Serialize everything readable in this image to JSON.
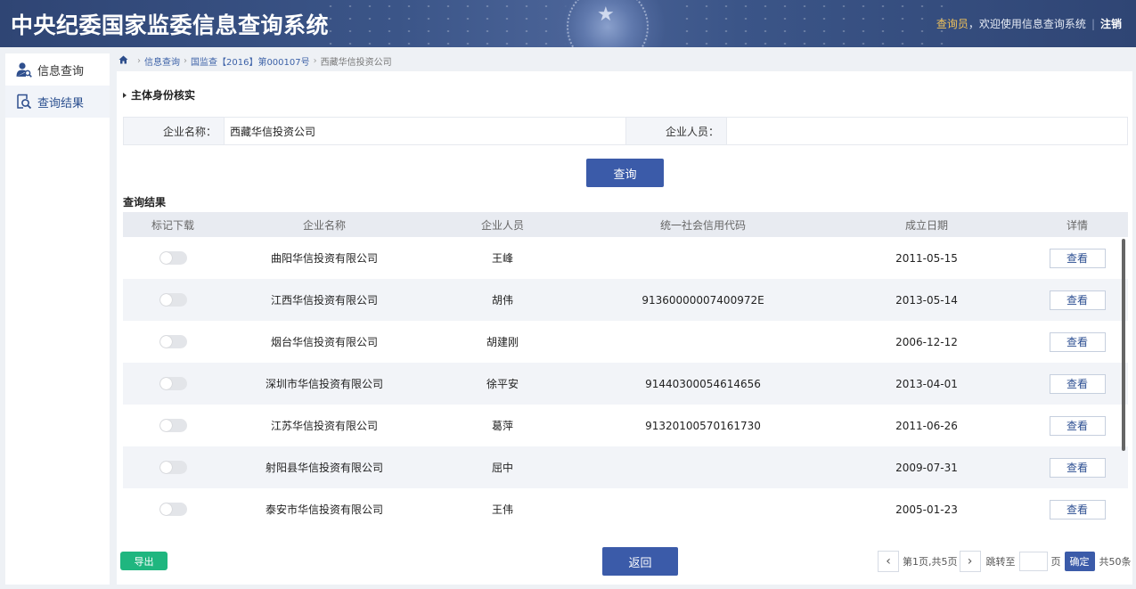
{
  "header": {
    "title": "中央纪委国家监委信息查询系统",
    "role": "查询员",
    "welcome": "，欢迎使用信息查询系统",
    "logout": "注销"
  },
  "sidebar": {
    "items": [
      {
        "label": "信息查询",
        "icon": "user-search-icon"
      },
      {
        "label": "查询结果",
        "icon": "result-search-icon"
      }
    ]
  },
  "breadcrumb": {
    "items": [
      "信息查询",
      "国监查【2016】第000107号"
    ],
    "current": "西藏华信投资公司"
  },
  "section": {
    "title": "主体身份核实"
  },
  "form": {
    "company_label": "企业名称：",
    "company_value": "西藏华信投资公司",
    "person_label": "企业人员：",
    "person_value": "",
    "query_button": "查询"
  },
  "results": {
    "title": "查询结果",
    "columns": [
      "标记下载",
      "企业名称",
      "企业人员",
      "统一社会信用代码",
      "成立日期",
      "详情"
    ],
    "view_label": "查看",
    "rows": [
      {
        "company": "曲阳华信投资有限公司",
        "person": "王峰",
        "code": "",
        "date": "2011-05-15"
      },
      {
        "company": "江西华信投资有限公司",
        "person": "胡伟",
        "code": "91360000007400972E",
        "date": "2013-05-14"
      },
      {
        "company": "烟台华信投资有限公司",
        "person": "胡建刚",
        "code": "",
        "date": "2006-12-12"
      },
      {
        "company": "深圳市华信投资有限公司",
        "person": "徐平安",
        "code": "91440300054614656",
        "date": "2013-04-01"
      },
      {
        "company": "江苏华信投资有限公司",
        "person": "葛萍",
        "code": "91320100570161730",
        "date": "2011-06-26"
      },
      {
        "company": "射阳县华信投资有限公司",
        "person": "屈中",
        "code": "",
        "date": "2009-07-31"
      },
      {
        "company": "泰安市华信投资有限公司",
        "person": "王伟",
        "code": "",
        "date": "2005-01-23"
      }
    ]
  },
  "footer": {
    "export": "导出",
    "back": "返回",
    "page_info": "第1页,共5页",
    "jump_label": "跳转至",
    "page_unit": "页",
    "confirm": "确定",
    "total": "共50条"
  },
  "colors": {
    "header_bg": "#3b5588",
    "primary": "#3b5ba9",
    "export_green": "#1fb67f",
    "role_gold": "#f0c15a"
  }
}
